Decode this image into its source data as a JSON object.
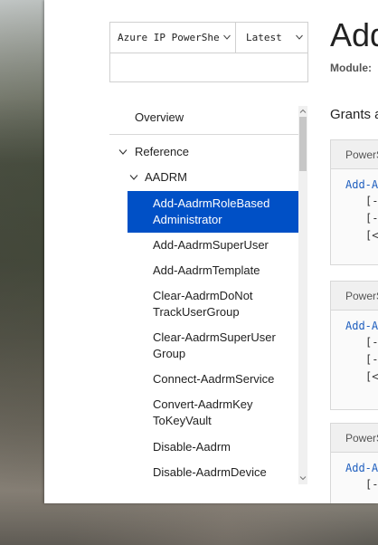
{
  "selectors": {
    "module": "Azure IP PowerShell",
    "version": "Latest"
  },
  "nav": {
    "overview": "Overview",
    "reference": "Reference",
    "group": "AADRM",
    "items": [
      "Add-AadrmRoleBased Administrator",
      "Add-AadrmSuperUser",
      "Add-AadrmTemplate",
      "Clear-AadrmDoNot TrackUserGroup",
      "Clear-AadrmSuperUser Group",
      "Connect-AadrmService",
      "Convert-AadrmKey ToKeyVault",
      "Disable-Aadrm",
      "Disable-AadrmDevice"
    ],
    "selected_index": 0
  },
  "content": {
    "title": "Add",
    "module_label": "Module:",
    "summary": "Grants a",
    "code_blocks": [
      {
        "header": "PowerShell",
        "command": "Add-A",
        "params": [
          "[-",
          "[-",
          "[<"
        ]
      },
      {
        "header": "PowerShell",
        "command": "Add-A",
        "params": [
          "[-",
          "[-",
          "[<"
        ]
      },
      {
        "header": "PowerShell",
        "command": "Add-A",
        "params": [
          "[-"
        ]
      }
    ]
  },
  "colors": {
    "accent": "#0050c6",
    "link": "#1f5fbf"
  }
}
